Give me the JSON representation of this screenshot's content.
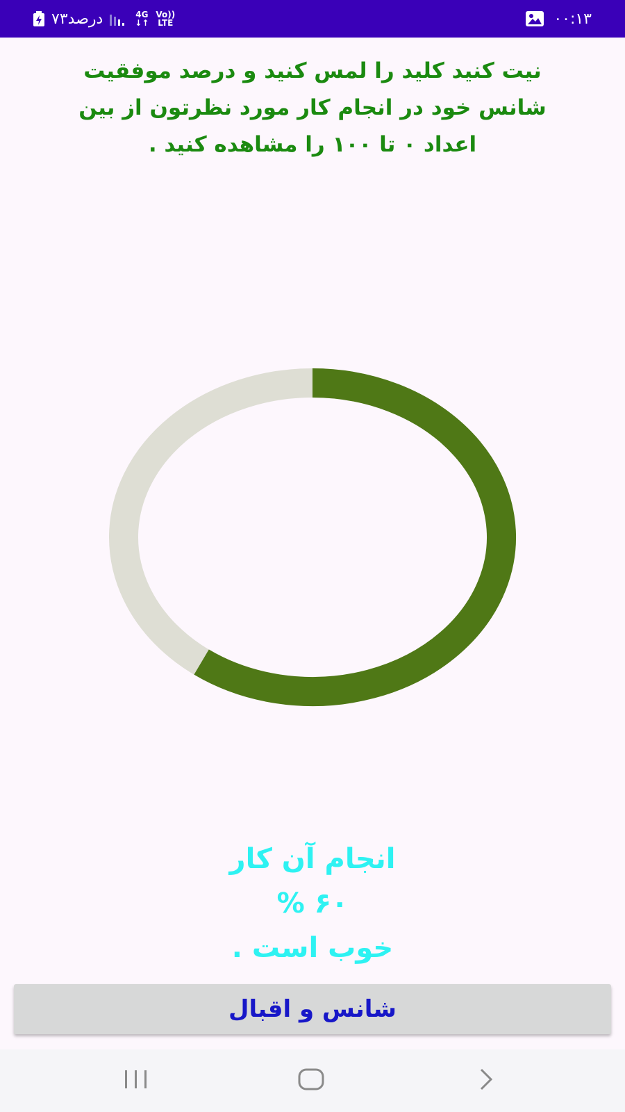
{
  "status_bar": {
    "battery_text": "۷۳درصد",
    "network_type": "4G",
    "volte_top": "Vo))",
    "volte_bottom": "LTE",
    "time": "۰۰:۱۳",
    "bg_color": "#3a00b8"
  },
  "instructions": {
    "line1": "نیت کنید کلید را لمس کنید و درصد موفقیت",
    "line2": "شانس خود در انجام کار مورد نظرتون از بین",
    "line3": "اعداد ۰ تا ۱۰۰ را مشاهده کنید .",
    "color": "#1b8a10"
  },
  "progress": {
    "value_fraction": 0.6,
    "fill_color": "#4f7816",
    "track_color": "#deded4"
  },
  "result": {
    "line1": "انجام آن کار",
    "line2": "۶۰ %",
    "line3": "خوب است .",
    "color": "#2ef2f2"
  },
  "button": {
    "label": "شانس و اقبال",
    "text_color": "#1717c8"
  },
  "nav_bar": {
    "recents_icon": "recents-icon",
    "home_icon": "home-icon",
    "back_icon": "back-icon"
  }
}
